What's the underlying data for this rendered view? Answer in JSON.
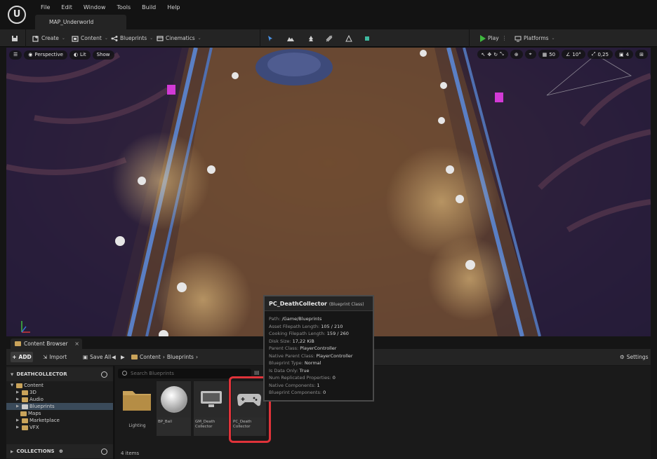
{
  "menu": {
    "items": [
      "File",
      "Edit",
      "Window",
      "Tools",
      "Build",
      "Help"
    ],
    "level_tab": "MAP_Underworld"
  },
  "toolbar": {
    "create": "Create",
    "content": "Content",
    "blueprints": "Blueprints",
    "cinematics": "Cinematics",
    "play": "Play",
    "platforms": "Platforms"
  },
  "viewport": {
    "perspective": "Perspective",
    "lit": "Lit",
    "show": "Show",
    "grid_snap": "50",
    "rotation_snap": "10°",
    "scale_snap": "0,25",
    "camera_speed": "4"
  },
  "content_browser": {
    "tab_label": "Content Browser",
    "add": "ADD",
    "import": "Import",
    "save_all": "Save All",
    "breadcrumb": [
      "Content",
      "Blueprints"
    ],
    "settings": "Settings",
    "project": "DEATHCOLLECTOR",
    "tree": [
      {
        "label": "Content",
        "depth": 0,
        "open": true
      },
      {
        "label": "3D",
        "depth": 1
      },
      {
        "label": "Audio",
        "depth": 1
      },
      {
        "label": "Blueprints",
        "depth": 1,
        "selected": true
      },
      {
        "label": "Maps",
        "depth": 1
      },
      {
        "label": "Marketplace",
        "depth": 1
      },
      {
        "label": "VFX",
        "depth": 1
      }
    ],
    "collections": "COLLECTIONS",
    "search_placeholder": "Search Blueprints",
    "assets": [
      {
        "name": "Lighting"
      },
      {
        "name": "BP_Ball"
      },
      {
        "name": "GM_Death Collector"
      },
      {
        "name": "PC_Death Collector"
      }
    ],
    "item_count": "4 items"
  },
  "tooltip": {
    "title": "PC_DeathCollector",
    "class": "(Blueprint Class)",
    "lines": [
      {
        "label": "Path:",
        "value": "/Game/Blueprints"
      },
      {
        "label": "Asset Filepath Length:",
        "value": "105 / 210"
      },
      {
        "label": "Cooking Filepath Length:",
        "value": "159 / 260"
      },
      {
        "label": "Disk Size:",
        "value": "17,22 KiB"
      },
      {
        "label": "Parent Class:",
        "value": "PlayerController"
      },
      {
        "label": "Native Parent Class:",
        "value": "PlayerController"
      },
      {
        "label": "Blueprint Type:",
        "value": "Normal"
      },
      {
        "label": "Is Data Only:",
        "value": "True"
      },
      {
        "label": "Num Replicated Properties:",
        "value": "0"
      },
      {
        "label": "Native Components:",
        "value": "1"
      },
      {
        "label": "Blueprint Components:",
        "value": "0"
      }
    ]
  },
  "colors": {
    "accent_highlight": "#e0333a",
    "play_green": "#3fb93f",
    "folder": "#c9a35a"
  }
}
